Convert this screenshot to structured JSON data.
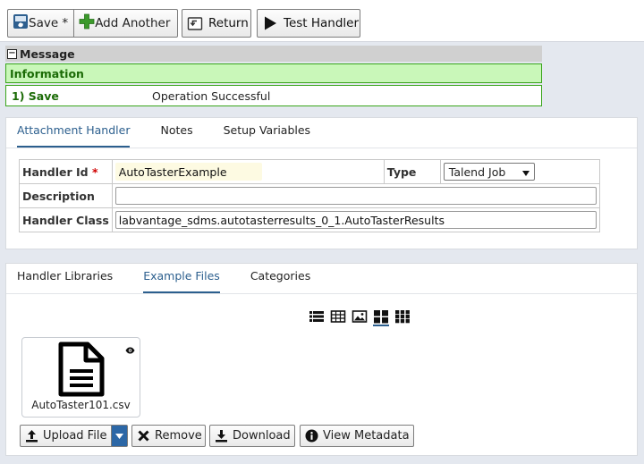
{
  "toolbar": {
    "save_label": "Save *",
    "add_another_label": "Add Another",
    "return_label": "Return",
    "test_handler_label": "Test Handler"
  },
  "message": {
    "header": "Message",
    "info_title": "Information",
    "row_key": "1) Save",
    "row_value": "Operation Successful"
  },
  "handler_panel": {
    "tabs": [
      {
        "label": "Attachment Handler",
        "active": true
      },
      {
        "label": "Notes",
        "active": false
      },
      {
        "label": "Setup Variables",
        "active": false
      }
    ],
    "fields": {
      "handler_id_label": "Handler Id",
      "required_mark": "*",
      "handler_id_value": "AutoTasterExample",
      "type_label": "Type",
      "type_value": "Talend Job",
      "description_label": "Description",
      "description_value": "",
      "handler_class_label": "Handler Class",
      "handler_class_value": "labvantage_sdms.autotasterresults_0_1.AutoTasterResults"
    }
  },
  "files_panel": {
    "tabs": [
      {
        "label": "Handler Libraries",
        "active": false
      },
      {
        "label": "Example Files",
        "active": true
      },
      {
        "label": "Categories",
        "active": false
      }
    ],
    "view_modes": [
      "list-view-icon",
      "table-view-icon",
      "image-view-icon",
      "large-grid-icon",
      "small-grid-icon"
    ],
    "active_view": "large-grid-icon",
    "files": [
      {
        "name": "AutoTaster101.csv"
      }
    ],
    "actions": {
      "upload_label": "Upload File",
      "remove_label": "Remove",
      "download_label": "Download",
      "view_metadata_label": "View Metadata"
    }
  },
  "colors": {
    "accent": "#2c5f8e",
    "success_bg": "#c9f7b9",
    "success_border": "#3aa51c",
    "success_text": "#1b6b06",
    "required": "#d00000",
    "highlight_input": "#fdfae2"
  }
}
